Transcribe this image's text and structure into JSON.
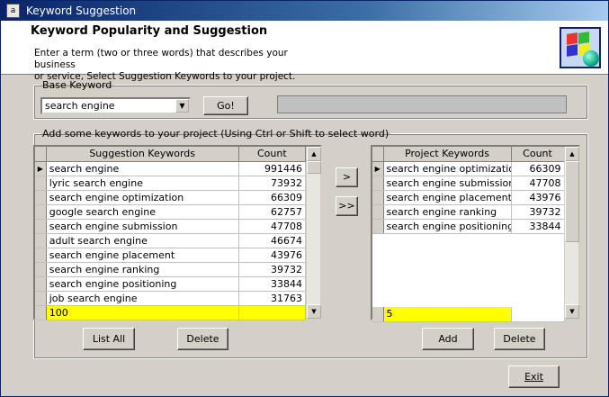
{
  "window": {
    "title": "Keyword Suggestion"
  },
  "header": {
    "title": "Keyword Popularity and Suggestion",
    "description_line1": "Enter a term (two or three words) that describes your business",
    "description_line2": "or service, Select Suggestion Keywords to your project."
  },
  "base": {
    "legend": "Base Keyword",
    "value": "search engine",
    "go_label": "Go!"
  },
  "add_group": {
    "legend": "Add some keywords to your project  (Using Ctrl or Shift to select word)"
  },
  "suggestions": {
    "headers": [
      "Suggestion Keywords",
      "Count"
    ],
    "rows": [
      {
        "kw": "search engine",
        "count": "991446"
      },
      {
        "kw": "lyric search engine",
        "count": "73932"
      },
      {
        "kw": "search engine optimization",
        "count": "66309"
      },
      {
        "kw": "google search engine",
        "count": "62757"
      },
      {
        "kw": "search engine submission",
        "count": "47708"
      },
      {
        "kw": "adult search engine",
        "count": "46674"
      },
      {
        "kw": "search engine placement",
        "count": "43976"
      },
      {
        "kw": "search engine ranking",
        "count": "39732"
      },
      {
        "kw": "search engine positioning",
        "count": "33844"
      },
      {
        "kw": "job search engine",
        "count": "31763"
      }
    ],
    "new_row_value": "100",
    "list_all_label": "List All",
    "delete_label": "Delete"
  },
  "transfer": {
    "add_one": ">",
    "add_all": ">>"
  },
  "project": {
    "headers": [
      "Project Keywords",
      "Count"
    ],
    "rows": [
      {
        "kw": "search engine optimization",
        "count": "66309"
      },
      {
        "kw": "search engine submission",
        "count": "47708"
      },
      {
        "kw": "search engine placement",
        "count": "43976"
      },
      {
        "kw": "search engine ranking",
        "count": "39732"
      },
      {
        "kw": "search engine positioning",
        "count": "33844"
      }
    ],
    "new_row_value": "5",
    "add_label": "Add",
    "delete_label": "Delete"
  },
  "exit_label": "Exit",
  "icons": {
    "title": "app-icon",
    "logo": "windows-globe-logo",
    "row_pointer": "row-pointer-icon"
  }
}
